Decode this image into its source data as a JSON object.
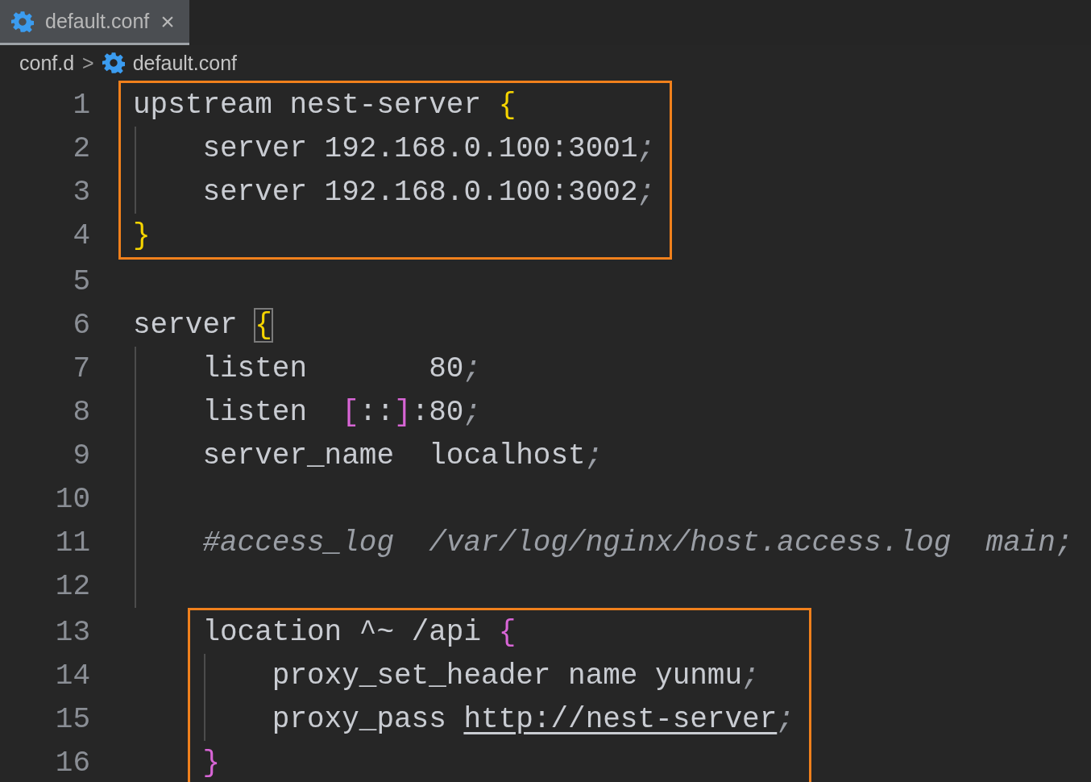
{
  "tabs": [
    {
      "label": "default.conf",
      "selected": true,
      "close": "×"
    }
  ],
  "breadcrumbs": [
    {
      "label": "conf.d"
    },
    {
      "label": "default.conf"
    }
  ],
  "breadcrumb_separator": ">",
  "blocks": [
    {
      "boxed": true,
      "lines": [
        {
          "number": "1",
          "segments": [
            {
              "kind": "text",
              "text": "upstream nest-server "
            },
            {
              "kind": "open",
              "text": "{"
            }
          ]
        },
        {
          "number": "2",
          "segments": [
            {
              "kind": "text",
              "text": "server 192.168.0.100:3001"
            },
            {
              "kind": "punct",
              "text": ";"
            }
          ]
        },
        {
          "number": "3",
          "segments": [
            {
              "kind": "text",
              "text": "server 192.168.0.100:3002"
            },
            {
              "kind": "punct",
              "text": ";"
            }
          ]
        },
        {
          "number": "4",
          "segments": [
            {
              "kind": "close",
              "text": "}"
            }
          ]
        }
      ]
    },
    {
      "boxed": false,
      "lines": [
        {
          "number": "5"
        },
        {
          "number": "6",
          "segments": [
            {
              "kind": "text",
              "text": "server "
            },
            {
              "kind": "open",
              "text": "{",
              "matched": true
            }
          ]
        },
        {
          "number": "7",
          "segments": [
            {
              "kind": "text",
              "text": "listen       80"
            },
            {
              "kind": "punct",
              "text": ";"
            }
          ]
        },
        {
          "number": "8",
          "segments": [
            {
              "kind": "text",
              "text": "listen  "
            },
            {
              "kind": "bracket",
              "text": "["
            },
            {
              "kind": "text",
              "text": "::"
            },
            {
              "kind": "bracket",
              "text": "]"
            },
            {
              "kind": "text",
              "text": ":80"
            },
            {
              "kind": "punct",
              "text": ";"
            }
          ]
        },
        {
          "number": "9",
          "segments": [
            {
              "kind": "text",
              "text": "server_name  localhost"
            },
            {
              "kind": "punct",
              "text": ";"
            }
          ]
        },
        {
          "number": "10"
        },
        {
          "number": "11",
          "segments": [
            {
              "kind": "comment",
              "text": "#access_log  /var/log/nginx/host.access.log  main;"
            }
          ]
        },
        {
          "number": "12"
        }
      ]
    },
    {
      "boxed": true,
      "lines": [
        {
          "number": "13",
          "segments": [
            {
              "kind": "text",
              "text": "location ^~ /api "
            },
            {
              "kind": "open",
              "text": "{"
            }
          ]
        },
        {
          "number": "14",
          "segments": [
            {
              "kind": "text",
              "text": "proxy_set_header name yunmu"
            },
            {
              "kind": "punct",
              "text": ";"
            }
          ]
        },
        {
          "number": "15",
          "segments": [
            {
              "kind": "text",
              "text": "proxy_pass "
            },
            {
              "kind": "link",
              "text": "http://nest-server"
            },
            {
              "kind": "punct",
              "text": ";"
            }
          ]
        },
        {
          "number": "16",
          "segments": [
            {
              "kind": "close",
              "text": "}"
            }
          ]
        }
      ]
    }
  ]
}
